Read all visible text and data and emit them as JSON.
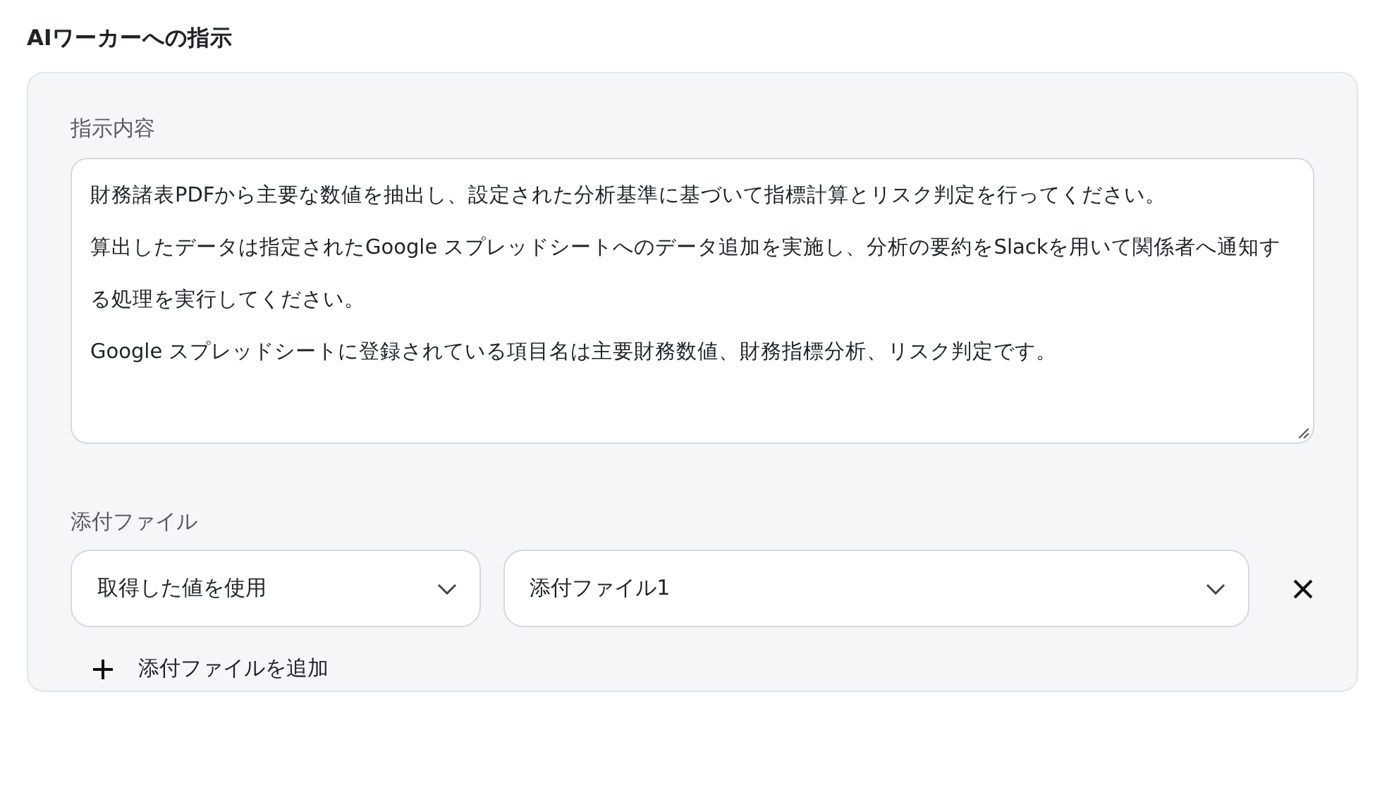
{
  "section_title": "AIワーカーへの指示",
  "instruction": {
    "label": "指示内容",
    "paragraphs": [
      "財務諸表PDFから主要な数値を抽出し、設定された分析基準に基づいて指標計算とリスク判定を行ってください。",
      "算出したデータは指定されたGoogle スプレッドシートへのデータ追加を実施し、分析の要約をSlackを用いて関係者へ通知する処理を実行してください。",
      "Google スプレッドシートに登録されている項目名は主要財務数値、財務指標分析、リスク判定です。"
    ]
  },
  "attachments": {
    "label": "添付ファイル",
    "rows": [
      {
        "source": "取得した値を使用",
        "file": "添付ファイル1"
      }
    ],
    "add_button": "添付ファイルを追加"
  }
}
